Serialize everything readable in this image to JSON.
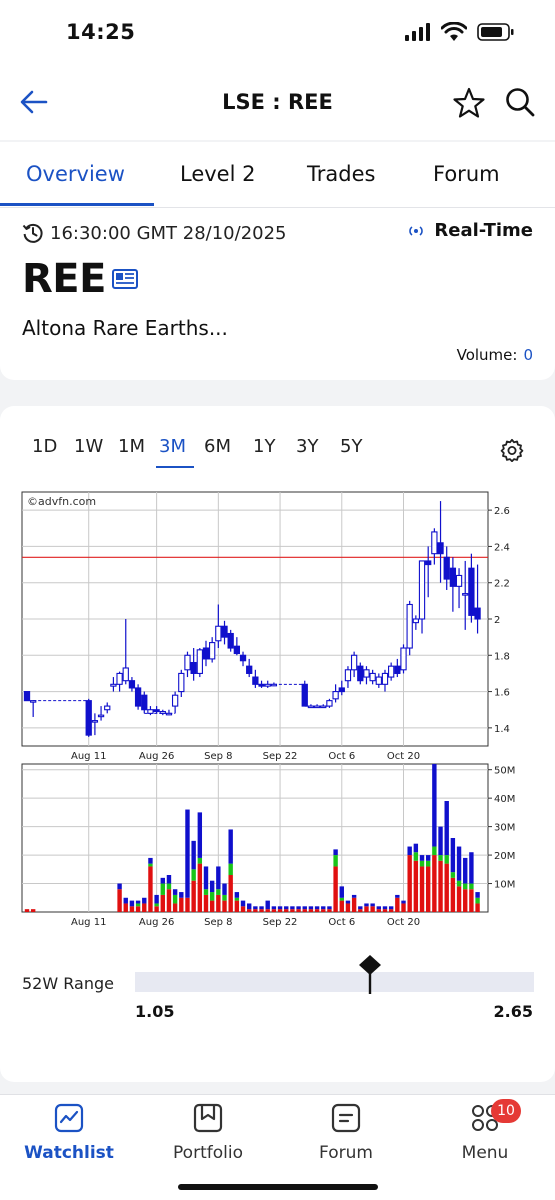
{
  "status": {
    "time": "14:25"
  },
  "nav": {
    "title": "LSE : REE"
  },
  "tabs": [
    "Overview",
    "Level 2",
    "Trades",
    "Forum"
  ],
  "info": {
    "timestamp": "16:30:00 GMT 28/10/2025",
    "realtime_label": "Real-Time",
    "ticker": "REE",
    "company": "Altona Rare Earths...",
    "volume_label": "Volume:",
    "volume_value": "0"
  },
  "periods": [
    "1D",
    "1W",
    "1M",
    "3M",
    "6M",
    "1Y",
    "3Y",
    "5Y"
  ],
  "active_period": "3M",
  "chart": {
    "watermark": "©advfn.com",
    "price_ticks": [
      "2.6",
      "2.4",
      "2.2",
      "2",
      "1.8",
      "1.6",
      "1.4"
    ],
    "x_labels": [
      "Aug 11",
      "Aug 26",
      "Sep 8",
      "Sep 22",
      "Oct 6",
      "Oct 20"
    ],
    "volume_ticks": [
      "50M",
      "40M",
      "30M",
      "20M",
      "10M"
    ],
    "reference_line": 2.34
  },
  "range": {
    "label": "52W Range",
    "low": "1.05",
    "high": "2.65",
    "current_fraction": 0.59
  },
  "bottom_nav": {
    "items": [
      "Watchlist",
      "Portfolio",
      "Forum",
      "Menu"
    ],
    "badge": "10"
  },
  "colors": {
    "accent": "#1b52c4",
    "up": "#1010cc",
    "down_vol": "#e01010",
    "mid_vol": "#19c419",
    "ref_line": "#e02020"
  },
  "chart_data": {
    "type": "candlestick",
    "ylim": [
      1.3,
      2.7
    ],
    "volume_ylim": [
      0,
      52
    ],
    "candles": [
      [
        0,
        1.6,
        1.6,
        1.55,
        1.55
      ],
      [
        1,
        1.55,
        1.55,
        1.46,
        1.55
      ],
      [
        10,
        1.55,
        1.56,
        1.35,
        1.36
      ],
      [
        11,
        1.44,
        1.48,
        1.36,
        1.44
      ],
      [
        12,
        1.47,
        1.52,
        1.44,
        1.47
      ],
      [
        13,
        1.5,
        1.54,
        1.48,
        1.52
      ],
      [
        14,
        1.63,
        1.68,
        1.6,
        1.64
      ],
      [
        15,
        1.64,
        1.71,
        1.6,
        1.7
      ],
      [
        16,
        1.66,
        2.0,
        1.64,
        1.73
      ],
      [
        17,
        1.66,
        1.68,
        1.6,
        1.62
      ],
      [
        18,
        1.62,
        1.64,
        1.5,
        1.52
      ],
      [
        19,
        1.58,
        1.6,
        1.48,
        1.5
      ],
      [
        20,
        1.48,
        1.52,
        1.47,
        1.5
      ],
      [
        21,
        1.5,
        1.52,
        1.48,
        1.49
      ],
      [
        22,
        1.48,
        1.5,
        1.47,
        1.49
      ],
      [
        23,
        1.48,
        1.5,
        1.47,
        1.48
      ],
      [
        24,
        1.52,
        1.6,
        1.48,
        1.58
      ],
      [
        25,
        1.6,
        1.72,
        1.57,
        1.7
      ],
      [
        26,
        1.72,
        1.82,
        1.68,
        1.8
      ],
      [
        27,
        1.76,
        1.84,
        1.66,
        1.7
      ],
      [
        28,
        1.7,
        1.84,
        1.68,
        1.83
      ],
      [
        29,
        1.84,
        1.88,
        1.74,
        1.78
      ],
      [
        30,
        1.78,
        1.9,
        1.76,
        1.87
      ],
      [
        31,
        1.88,
        2.08,
        1.84,
        1.96
      ],
      [
        32,
        1.96,
        1.99,
        1.86,
        1.9
      ],
      [
        33,
        1.92,
        1.94,
        1.82,
        1.84
      ],
      [
        34,
        1.85,
        1.9,
        1.8,
        1.81
      ],
      [
        35,
        1.8,
        1.82,
        1.74,
        1.77
      ],
      [
        36,
        1.74,
        1.78,
        1.68,
        1.7
      ],
      [
        37,
        1.68,
        1.72,
        1.62,
        1.64
      ],
      [
        38,
        1.64,
        1.66,
        1.62,
        1.63
      ],
      [
        39,
        1.63,
        1.66,
        1.62,
        1.64
      ],
      [
        40,
        1.64,
        1.65,
        1.63,
        1.64
      ],
      [
        45,
        1.64,
        1.66,
        1.52,
        1.52
      ],
      [
        46,
        1.52,
        1.53,
        1.51,
        1.52
      ],
      [
        47,
        1.52,
        1.53,
        1.51,
        1.52
      ],
      [
        48,
        1.52,
        1.53,
        1.51,
        1.52
      ],
      [
        49,
        1.52,
        1.56,
        1.51,
        1.55
      ],
      [
        50,
        1.56,
        1.64,
        1.54,
        1.6
      ],
      [
        51,
        1.62,
        1.66,
        1.58,
        1.6
      ],
      [
        52,
        1.66,
        1.74,
        1.62,
        1.72
      ],
      [
        53,
        1.72,
        1.82,
        1.68,
        1.8
      ],
      [
        54,
        1.74,
        1.76,
        1.64,
        1.66
      ],
      [
        55,
        1.68,
        1.74,
        1.64,
        1.72
      ],
      [
        56,
        1.66,
        1.72,
        1.64,
        1.7
      ],
      [
        57,
        1.64,
        1.7,
        1.62,
        1.68
      ],
      [
        58,
        1.64,
        1.72,
        1.6,
        1.7
      ],
      [
        59,
        1.68,
        1.76,
        1.66,
        1.74
      ],
      [
        60,
        1.74,
        1.78,
        1.68,
        1.7
      ],
      [
        61,
        1.72,
        1.86,
        1.7,
        1.84
      ],
      [
        62,
        1.84,
        2.1,
        1.8,
        2.08
      ],
      [
        63,
        1.98,
        2.02,
        1.94,
        2.0
      ],
      [
        64,
        2.0,
        2.32,
        1.92,
        2.32
      ],
      [
        65,
        2.32,
        2.4,
        2.12,
        2.3
      ],
      [
        66,
        2.36,
        2.5,
        2.3,
        2.48
      ],
      [
        67,
        2.42,
        2.65,
        2.2,
        2.36
      ],
      [
        68,
        2.34,
        2.4,
        2.16,
        2.22
      ],
      [
        69,
        2.28,
        2.34,
        2.04,
        2.18
      ],
      [
        70,
        2.18,
        2.28,
        2.06,
        2.24
      ],
      [
        71,
        2.14,
        2.32,
        1.94,
        2.14
      ],
      [
        72,
        2.28,
        2.36,
        1.98,
        2.02
      ],
      [
        73,
        2.06,
        2.3,
        1.92,
        2.0
      ]
    ],
    "volumes": [
      [
        0,
        1,
        0,
        0
      ],
      [
        1,
        1,
        0,
        0
      ],
      [
        15,
        8,
        0,
        2
      ],
      [
        16,
        3,
        0,
        2
      ],
      [
        17,
        2,
        0,
        2
      ],
      [
        18,
        2,
        1,
        1
      ],
      [
        19,
        3,
        0,
        2
      ],
      [
        20,
        16,
        1,
        2
      ],
      [
        21,
        2,
        1,
        3
      ],
      [
        22,
        6,
        4,
        2
      ],
      [
        23,
        8,
        2,
        3
      ],
      [
        24,
        3,
        3,
        2
      ],
      [
        25,
        5,
        0,
        2
      ],
      [
        26,
        5,
        0,
        31
      ],
      [
        27,
        11,
        4,
        10
      ],
      [
        28,
        17,
        2,
        16
      ],
      [
        29,
        6,
        2,
        8
      ],
      [
        30,
        4,
        3,
        4
      ],
      [
        31,
        6,
        2,
        8
      ],
      [
        32,
        4,
        2,
        4
      ],
      [
        33,
        13,
        4,
        12
      ],
      [
        34,
        4,
        1,
        2
      ],
      [
        35,
        2,
        0,
        2
      ],
      [
        36,
        1,
        0,
        2
      ],
      [
        37,
        1,
        0,
        1
      ],
      [
        38,
        1,
        0,
        1
      ],
      [
        39,
        1,
        0,
        3
      ],
      [
        40,
        1,
        0,
        1
      ],
      [
        41,
        1,
        0,
        1
      ],
      [
        42,
        1,
        0,
        1
      ],
      [
        43,
        1,
        0,
        1
      ],
      [
        44,
        1,
        0,
        1
      ],
      [
        45,
        1,
        0,
        1
      ],
      [
        46,
        1,
        0,
        1
      ],
      [
        47,
        1,
        0,
        1
      ],
      [
        48,
        1,
        0,
        1
      ],
      [
        49,
        1,
        0,
        1
      ],
      [
        50,
        16,
        4,
        2
      ],
      [
        51,
        4,
        1,
        4
      ],
      [
        52,
        3,
        0,
        1
      ],
      [
        53,
        5,
        0,
        1
      ],
      [
        54,
        1,
        0,
        1
      ],
      [
        55,
        2,
        0,
        1
      ],
      [
        56,
        2,
        0,
        1
      ],
      [
        57,
        1,
        0,
        1
      ],
      [
        58,
        1,
        0,
        1
      ],
      [
        59,
        1,
        0,
        1
      ],
      [
        60,
        5,
        0,
        1
      ],
      [
        61,
        3,
        0,
        1
      ],
      [
        62,
        20,
        0,
        3
      ],
      [
        63,
        18,
        3,
        3
      ],
      [
        64,
        16,
        2,
        2
      ],
      [
        65,
        16,
        2,
        2
      ],
      [
        66,
        20,
        3,
        29
      ],
      [
        67,
        18,
        2,
        10
      ],
      [
        68,
        17,
        3,
        19
      ],
      [
        69,
        12,
        2,
        12
      ],
      [
        70,
        9,
        2,
        12
      ],
      [
        71,
        8,
        2,
        9
      ],
      [
        72,
        8,
        2,
        11
      ],
      [
        73,
        3,
        2,
        2
      ]
    ]
  }
}
